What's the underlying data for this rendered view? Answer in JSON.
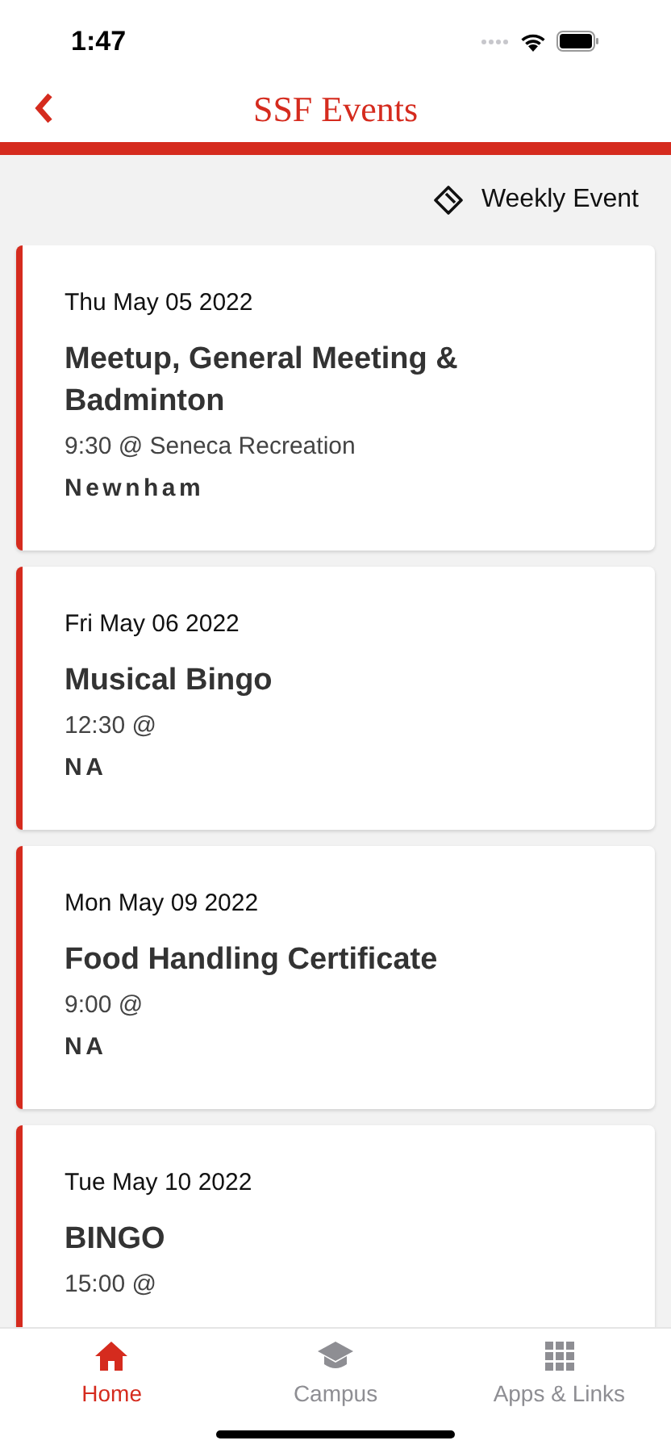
{
  "status_bar": {
    "time": "1:47"
  },
  "header": {
    "title": "SSF Events"
  },
  "legend": {
    "label": "Weekly Event"
  },
  "events": [
    {
      "date": "Thu May 05 2022",
      "title": "Meetup, General Meeting & Badminton",
      "time": "9:30 @ Seneca Recreation",
      "location": "Newnham"
    },
    {
      "date": "Fri May 06 2022",
      "title": "Musical Bingo",
      "time": "12:30 @",
      "location": "NA"
    },
    {
      "date": "Mon May 09 2022",
      "title": "Food Handling Certificate",
      "time": "9:00 @",
      "location": "NA"
    },
    {
      "date": "Tue May 10 2022",
      "title": "BINGO",
      "time": "15:00 @"
    }
  ],
  "tabs": [
    {
      "kind": "home",
      "label": "Home",
      "selected": true
    },
    {
      "kind": "campus",
      "label": "Campus",
      "selected": false
    },
    {
      "kind": "apps",
      "label": "Apps & Links",
      "selected": false
    }
  ]
}
